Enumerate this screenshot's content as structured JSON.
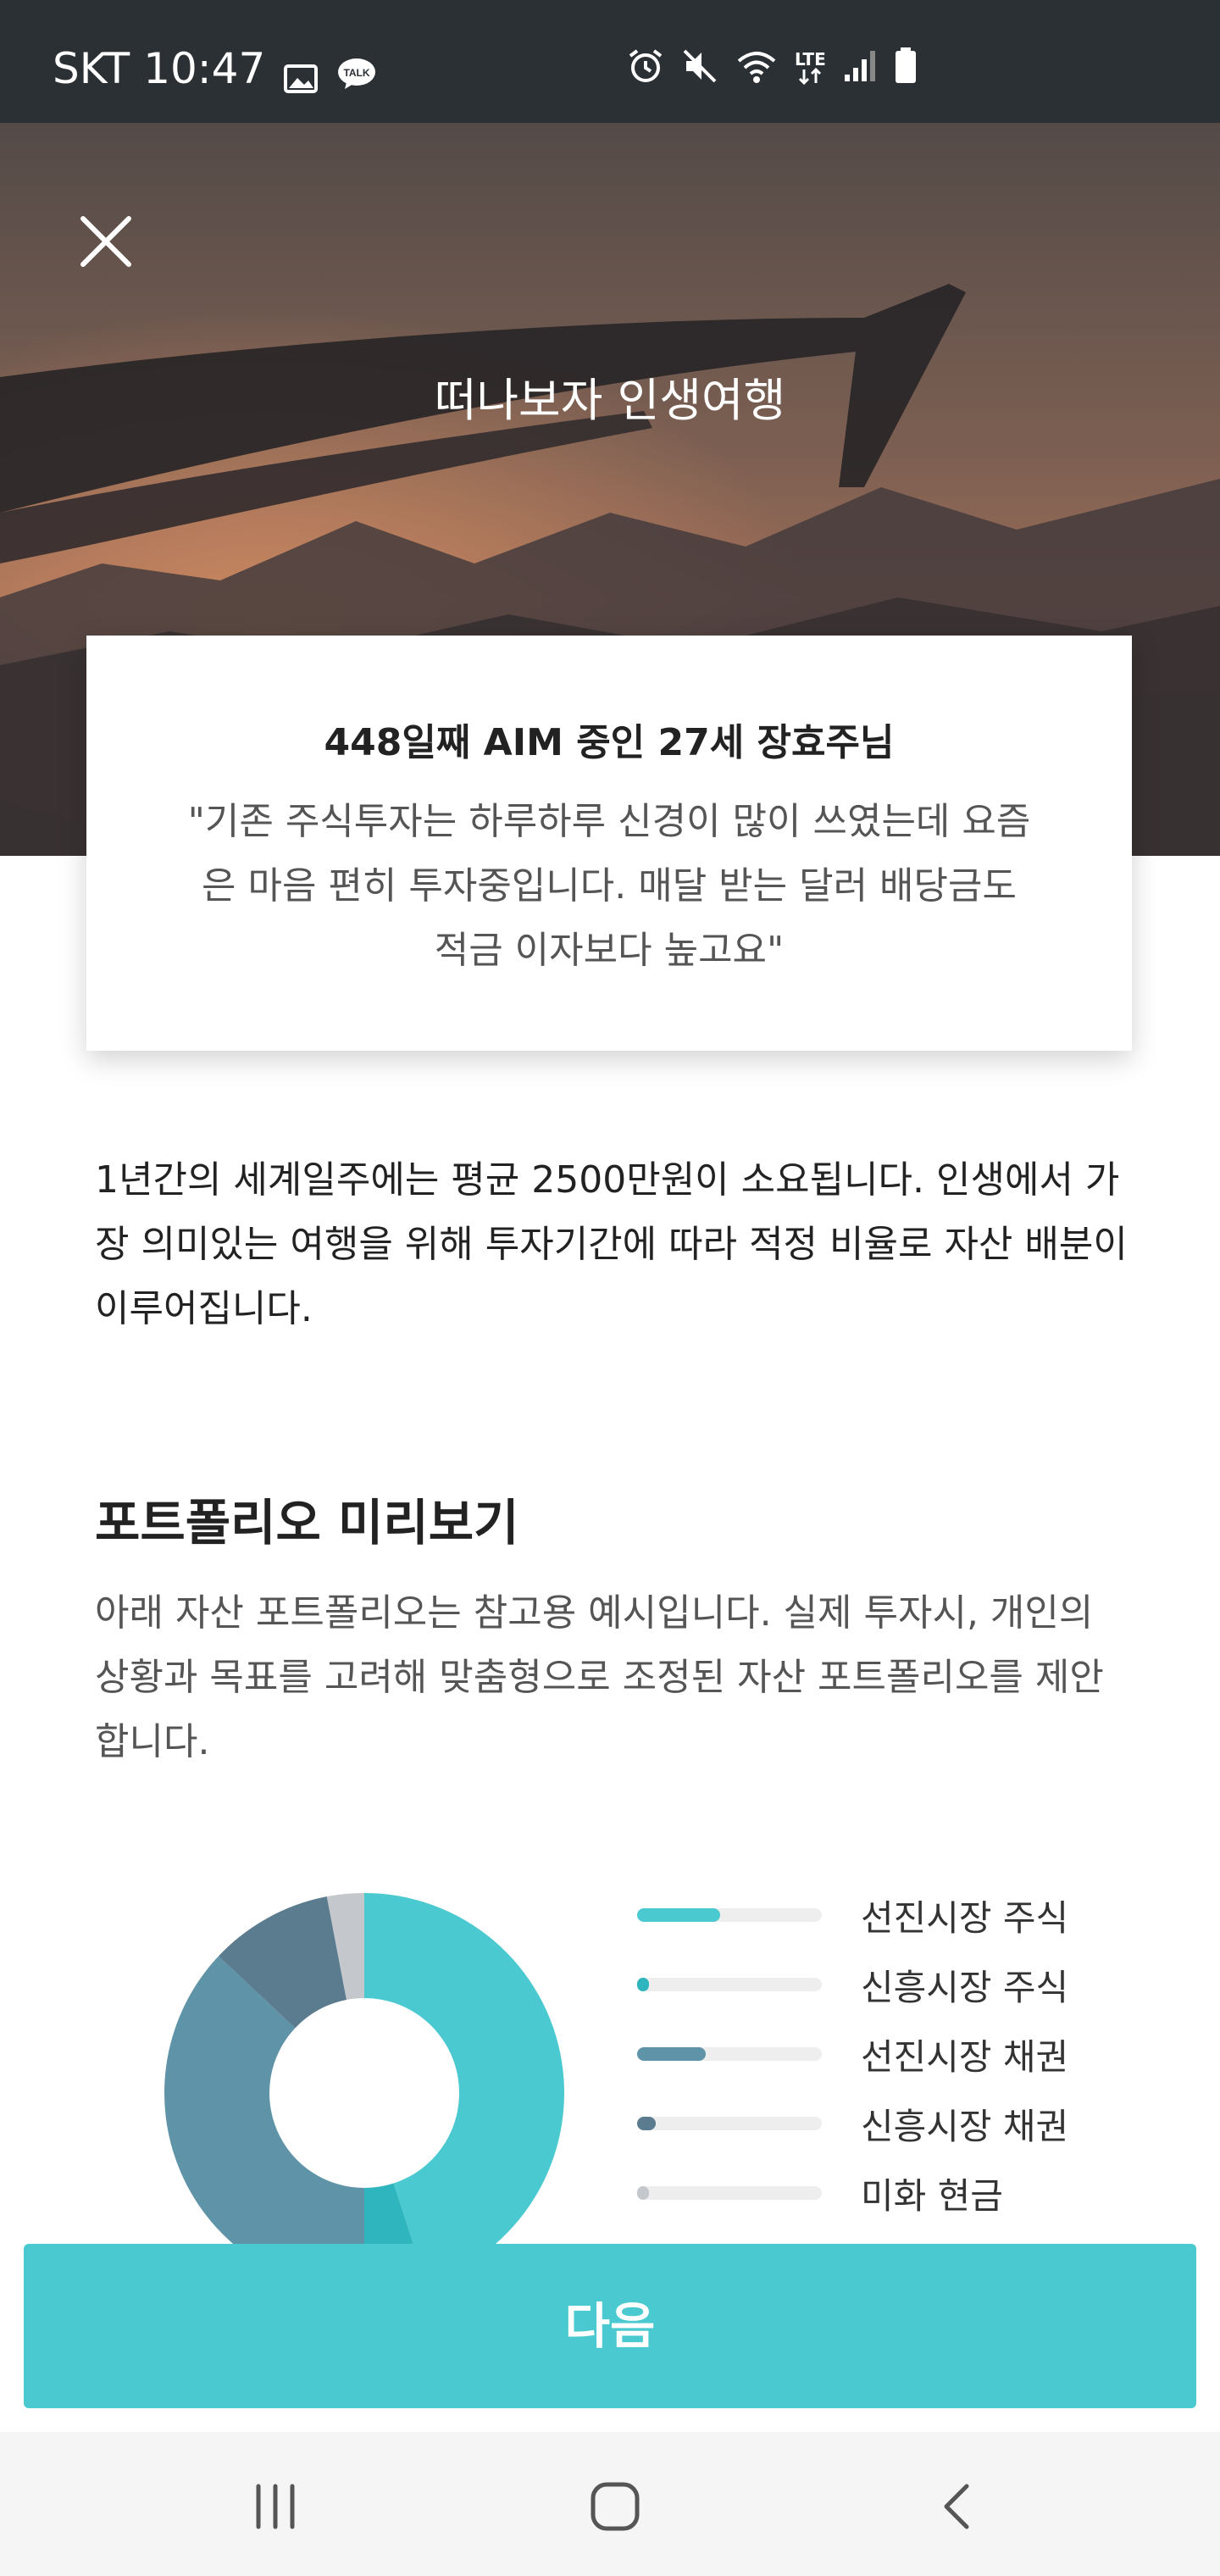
{
  "status_bar": {
    "carrier": "SKT",
    "time": "10:47",
    "network": "LTE",
    "left_icons": [
      "gallery-icon",
      "kakaotalk-icon"
    ],
    "right_icons": [
      "alarm-icon",
      "mute-icon",
      "wifi-icon",
      "lte-icon",
      "signal-icon",
      "battery-icon"
    ]
  },
  "hero": {
    "title": "떠나보자 인생여행",
    "close_icon": "close-icon"
  },
  "testimonial": {
    "name": "448일째 AIM 중인 27세 장효주님",
    "quote": "\"기존 주식투자는 하루하루 신경이 많이 쓰였는데 요즘은 마음 편히 투자중입니다. 매달 받는 달러 배당금도 적금 이자보다 높고요\""
  },
  "intro": "1년간의 세계일주에는 평균 2500만원이 소요됩니다. 인생에서 가장 의미있는 여행을 위해 투자기간에 따라 적정 비율로 자산 배분이 이루어집니다.",
  "portfolio": {
    "title": "포트폴리오 미리보기",
    "description": "아래 자산 포트폴리오는 참고용 예시입니다. 실제 투자시, 개인의 상황과 목표를 고려해 맞춤형으로 조정된 자산 포트폴리오를 제안합니다."
  },
  "chart_data": {
    "type": "pie",
    "donut": true,
    "categories": [
      "선진시장 주식",
      "신흥시장 주식",
      "선진시장 채권",
      "신흥시장 채권",
      "미화 현금"
    ],
    "values": [
      0.45,
      0.05,
      0.37,
      0.1,
      0.03
    ],
    "colors": [
      "#4bc9d0",
      "#2fb5bd",
      "#5f93a8",
      "#5b7b8f",
      "#c4c8cc"
    ],
    "legend_placement": "right"
  },
  "next_button": "다음",
  "nav": {
    "recent_icon": "recent-apps-icon",
    "home_icon": "home-icon",
    "back_icon": "back-icon"
  }
}
